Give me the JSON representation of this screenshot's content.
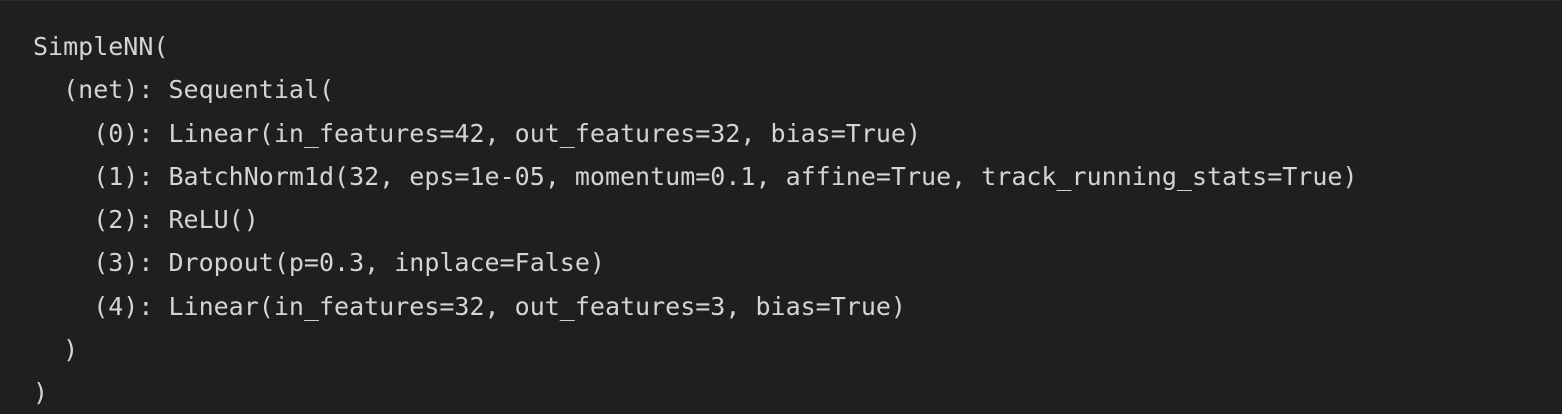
{
  "output": {
    "lines": [
      "SimpleNN(",
      "  (net): Sequential(",
      "    (0): Linear(in_features=42, out_features=32, bias=True)",
      "    (1): BatchNorm1d(32, eps=1e-05, momentum=0.1, affine=True, track_running_stats=True)",
      "    (2): ReLU()",
      "    (3): Dropout(p=0.3, inplace=False)",
      "    (4): Linear(in_features=32, out_features=3, bias=True)",
      "  )",
      ")"
    ]
  },
  "colors": {
    "background": "#1f1f1f",
    "text": "#d4d4d4"
  }
}
